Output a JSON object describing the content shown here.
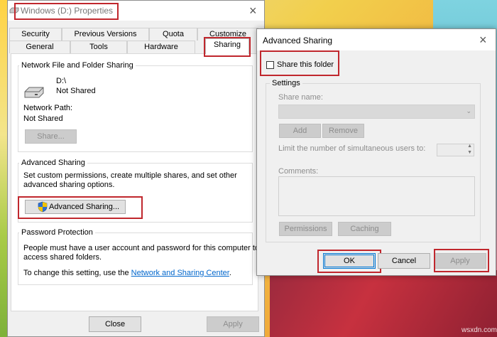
{
  "props_window": {
    "title": "Windows (D:) Properties",
    "tabs_row1": [
      "Security",
      "Previous Versions",
      "Quota",
      "Customize"
    ],
    "tabs_row2": [
      "General",
      "Tools",
      "Hardware",
      "Sharing"
    ],
    "active_tab": "Sharing",
    "network_sharing": {
      "heading": "Network File and Folder Sharing",
      "drive_name": "D:\\",
      "drive_status": "Not Shared",
      "network_path_label": "Network Path:",
      "network_path_value": "Not Shared",
      "share_button": "Share..."
    },
    "advanced_sharing": {
      "heading": "Advanced Sharing",
      "description_line1": "Set custom permissions, create multiple shares, and set other",
      "description_line2": "advanced sharing options.",
      "button": "Advanced Sharing..."
    },
    "password_protection": {
      "heading": "Password Protection",
      "line1": "People must have a user account and password for this computer to",
      "line2": "access shared folders.",
      "change_prefix": "To change this setting, use the ",
      "link_text": "Network and Sharing Center",
      "change_suffix": "."
    },
    "buttons": {
      "close": "Close",
      "apply": "Apply"
    }
  },
  "adv_dialog": {
    "title": "Advanced Sharing",
    "share_checkbox_label": "Share this folder",
    "share_checked": false,
    "settings_heading": "Settings",
    "share_name_label": "Share name:",
    "add_button": "Add",
    "remove_button": "Remove",
    "limit_label": "Limit the number of simultaneous users to:",
    "comments_label": "Comments:",
    "permissions_button": "Permissions",
    "caching_button": "Caching",
    "ok_button": "OK",
    "cancel_button": "Cancel",
    "apply_button": "Apply"
  },
  "watermark": "wsxdn.com",
  "colors": {
    "highlight": "#c0272d",
    "link": "#0066cc",
    "focus": "#0078d7"
  }
}
